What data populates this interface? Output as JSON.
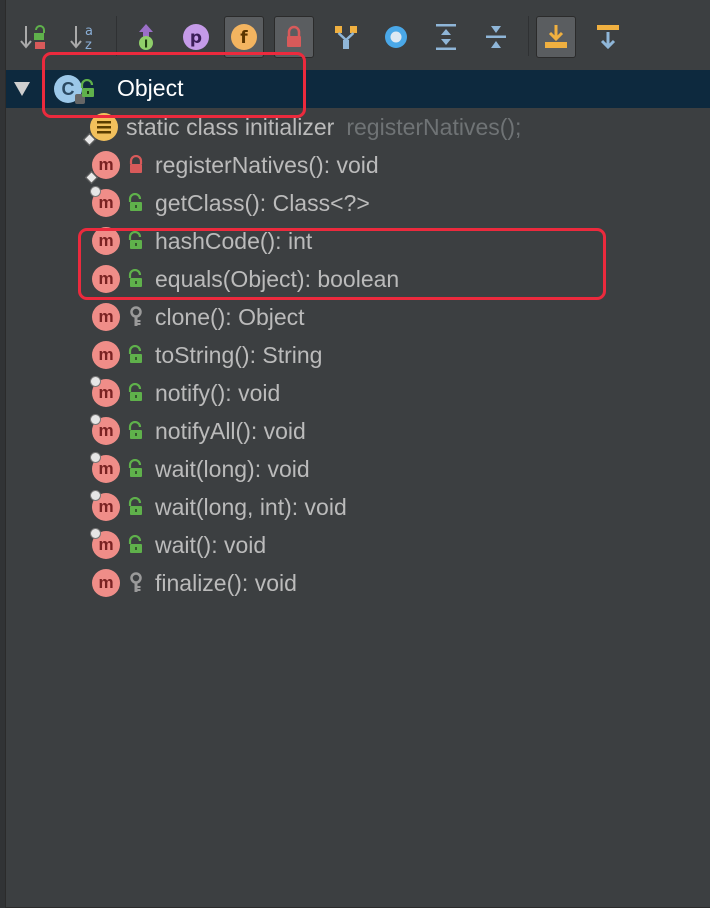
{
  "toolbar": {
    "buttons": [
      {
        "icon": "sort-by-visibility-icon",
        "toggled": false
      },
      {
        "icon": "sort-alphabetically-icon",
        "toggled": false
      },
      {
        "icon": "show-inherited-icon",
        "toggled": false
      },
      {
        "icon": "show-properties-icon",
        "toggled": false
      },
      {
        "icon": "show-fields-icon",
        "toggled": true
      },
      {
        "icon": "show-non-public-icon",
        "toggled": true
      },
      {
        "icon": "show-lambdas-icon",
        "toggled": false
      },
      {
        "icon": "show-anonymous-icon",
        "toggled": false
      },
      {
        "icon": "expand-all-icon",
        "toggled": false
      },
      {
        "icon": "collapse-all-icon",
        "toggled": false
      },
      {
        "icon": "autoscroll-to-source-icon",
        "toggled": true
      },
      {
        "icon": "autoscroll-from-source-icon",
        "toggled": false
      }
    ],
    "field_glyph": "f",
    "property_glyph": "p",
    "inherited_glyph": "I",
    "sort_alpha_top": "a",
    "sort_alpha_bottom": "z"
  },
  "tree": {
    "root": {
      "label": "Object",
      "icon": "class-icon",
      "glyph": "C",
      "access": "public",
      "expanded": true
    },
    "initializer": {
      "label": "static class initializer",
      "hint": "registerNatives();"
    },
    "method_glyph": "m",
    "members": [
      {
        "label": "registerNatives(): void",
        "access": "private",
        "overlay": false,
        "highlighted": false
      },
      {
        "label": "getClass(): Class<?>",
        "access": "public",
        "overlay": true,
        "highlighted": false
      },
      {
        "label": "hashCode(): int",
        "access": "public",
        "overlay": false,
        "highlighted": true
      },
      {
        "label": "equals(Object): boolean",
        "access": "public",
        "overlay": false,
        "highlighted": true
      },
      {
        "label": "clone(): Object",
        "access": "protected",
        "overlay": false,
        "highlighted": false
      },
      {
        "label": "toString(): String",
        "access": "public",
        "overlay": false,
        "highlighted": false
      },
      {
        "label": "notify(): void",
        "access": "public",
        "overlay": true,
        "highlighted": false
      },
      {
        "label": "notifyAll(): void",
        "access": "public",
        "overlay": true,
        "highlighted": false
      },
      {
        "label": "wait(long): void",
        "access": "public",
        "overlay": true,
        "highlighted": false
      },
      {
        "label": "wait(long, int): void",
        "access": "public",
        "overlay": true,
        "highlighted": false
      },
      {
        "label": "wait(): void",
        "access": "public",
        "overlay": true,
        "highlighted": false
      },
      {
        "label": "finalize(): void",
        "access": "protected",
        "overlay": false,
        "highlighted": false
      }
    ]
  },
  "colors": {
    "background": "#3c3f41",
    "selection": "#0d293e",
    "highlight_box": "#ec2a3d",
    "method_icon": "#ef8d88",
    "public_lock": "#5fb14b",
    "private_lock": "#d85a5a",
    "protected_key": "#9a9a9a"
  }
}
